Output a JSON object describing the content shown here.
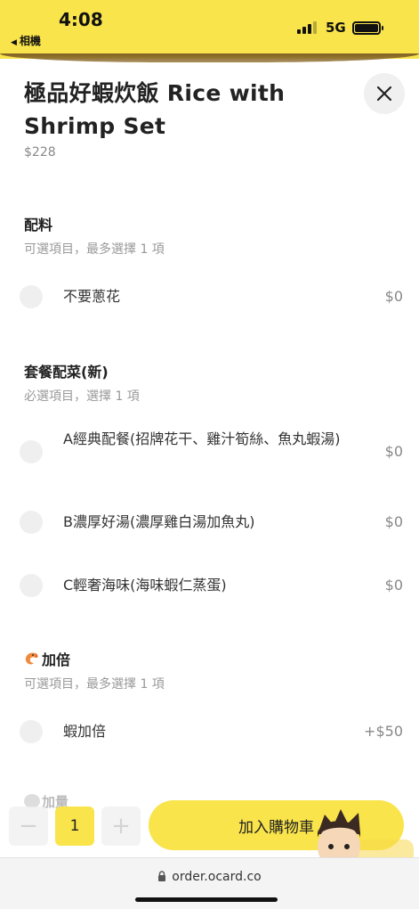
{
  "status": {
    "time": "4:08",
    "back_app": "相機",
    "network": "5G"
  },
  "item": {
    "title": "極品好蝦炊飯 Rice with Shrimp Set",
    "price": "$228"
  },
  "groups": [
    {
      "title": "配料",
      "subtitle": "可選項目，最多選擇 1 項",
      "options": [
        {
          "label": "不要蔥花",
          "price": "$0"
        }
      ]
    },
    {
      "title": "套餐配菜(新)",
      "subtitle": "必選項目，選擇 1 項",
      "options": [
        {
          "label": "A經典配餐(招牌花干、雞汁筍絲、魚丸蝦湯)",
          "price": "$0"
        },
        {
          "label": "B濃厚好湯(濃厚雞白湯加魚丸)",
          "price": "$0"
        },
        {
          "label": "C輕奢海味(海味蝦仁蒸蛋)",
          "price": "$0"
        }
      ]
    },
    {
      "title": "加倍",
      "subtitle": "可選項目，最多選擇 1 項",
      "options": [
        {
          "label": "蝦加倍",
          "price": "+$50"
        }
      ]
    }
  ],
  "partial_group": {
    "title": "加量"
  },
  "bottom": {
    "quantity": "1",
    "minus": "−",
    "plus": "+",
    "add_to_cart": "加入購物車"
  },
  "browser": {
    "url": "order.ocard.co"
  },
  "colors": {
    "accent": "#f9e44b",
    "radio": "#efefef"
  },
  "icons": {
    "close": "close-icon",
    "lock": "lock-icon",
    "shrimp": "shrimp-icon"
  }
}
